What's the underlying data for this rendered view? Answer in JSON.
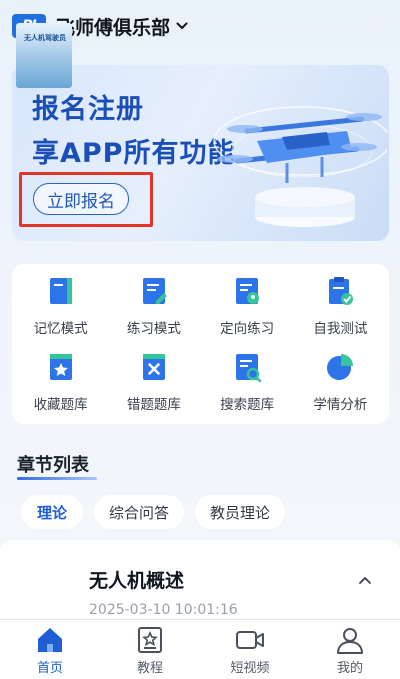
{
  "header": {
    "logo_text": "PJ",
    "club_name": "飞师傅俱乐部"
  },
  "banner": {
    "line1": "报名注册",
    "line2": "享APP所有功能",
    "register_button": "立即报名"
  },
  "features": [
    {
      "label": "记忆模式",
      "icon": "book-icon"
    },
    {
      "label": "练习模式",
      "icon": "edit-doc-icon"
    },
    {
      "label": "定向练习",
      "icon": "location-doc-icon"
    },
    {
      "label": "自我测试",
      "icon": "clipboard-check-icon"
    },
    {
      "label": "收藏题库",
      "icon": "star-doc-icon"
    },
    {
      "label": "错题题库",
      "icon": "x-doc-icon"
    },
    {
      "label": "搜索题库",
      "icon": "search-doc-icon"
    },
    {
      "label": "学情分析",
      "icon": "pie-chart-icon"
    }
  ],
  "section": {
    "title": "章节列表"
  },
  "tabs": [
    {
      "label": "理论",
      "active": true
    },
    {
      "label": "综合问答",
      "active": false
    },
    {
      "label": "教员理论",
      "active": false
    }
  ],
  "chapter": {
    "thumbnail_text": "无人机驾驶员",
    "title": "无人机概述",
    "timestamp": "2025-03-10 10:01:16"
  },
  "nav": [
    {
      "label": "首页",
      "icon": "home-icon",
      "active": true
    },
    {
      "label": "教程",
      "icon": "tutorial-icon",
      "active": false
    },
    {
      "label": "短视频",
      "icon": "video-icon",
      "active": false
    },
    {
      "label": "我的",
      "icon": "profile-icon",
      "active": false
    }
  ],
  "colors": {
    "accent": "#1f5fd6",
    "highlight_border": "#e2352a",
    "icon_blue": "#2c74e8",
    "icon_green": "#36c59a"
  }
}
